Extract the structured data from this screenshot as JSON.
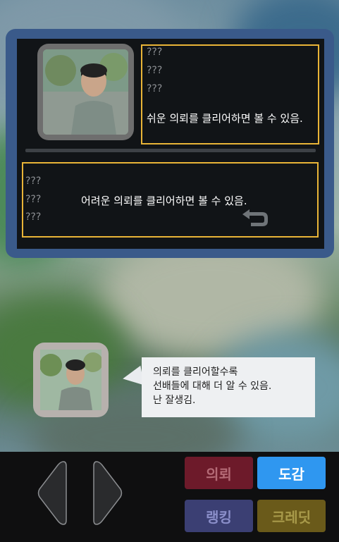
{
  "panel": {
    "easy_unknown": [
      "???",
      "???",
      "???"
    ],
    "easy_message": "쉬운 의뢰를 클리어하면 볼 수 있음.",
    "hard_unknown": [
      "???",
      "???",
      "???"
    ],
    "hard_message": "어려운 의뢰를 클리어하면 볼 수 있음."
  },
  "dialog": {
    "lines": [
      "의뢰를 클리어할수록",
      "선배들에 대해 더 알 수 있음.",
      "난 잘생김."
    ]
  },
  "menu": {
    "quest_label": "의뢰",
    "book_label": "도감",
    "ranking_label": "랭킹",
    "credits_label": "크레딧"
  },
  "colors": {
    "panel_border": "#3a5a8a",
    "box_border": "#e9b437",
    "book_active": "#2f97f0"
  },
  "icons": [
    "back-arrow-icon",
    "left-arrow-icon",
    "right-arrow-icon"
  ]
}
